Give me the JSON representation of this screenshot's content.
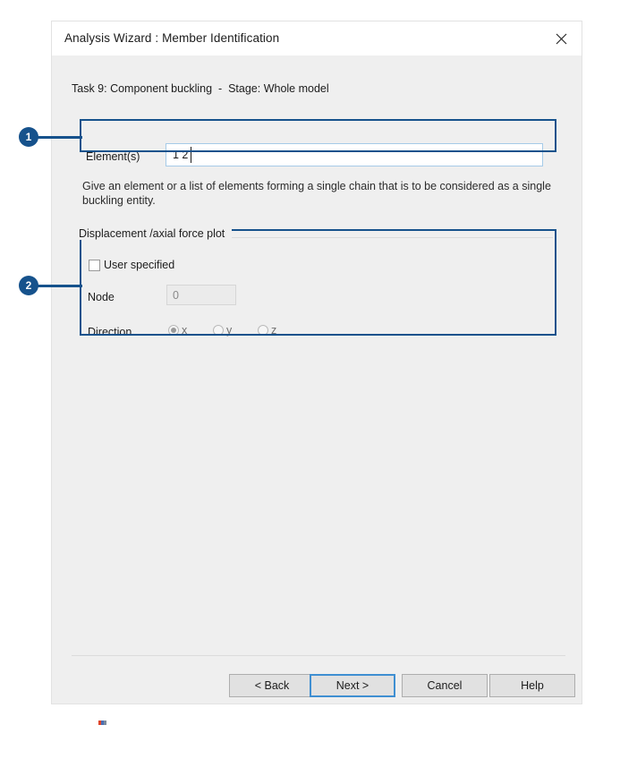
{
  "window": {
    "title": "Analysis Wizard : Member Identification",
    "close_icon": "close-icon"
  },
  "content": {
    "task_line": "Task 9: Component buckling  -  Stage: Whole model",
    "elements": {
      "label": "Element(s)",
      "value": "1 2",
      "placeholder": ""
    },
    "help_text": "Give an element or a list of elements forming a single chain that is to be considered as a single buckling entity.",
    "group": {
      "header": "Displacement /axial force plot",
      "user_specified": {
        "label": "User specified",
        "checked": false
      },
      "node": {
        "label": "Node",
        "value": "0",
        "enabled": false
      },
      "direction": {
        "label": "Direction",
        "selected": "x",
        "options": [
          {
            "value": "x",
            "label": "x",
            "checked": true
          },
          {
            "value": "y",
            "label": "y",
            "checked": false
          },
          {
            "value": "z",
            "label": "z",
            "checked": false
          }
        ]
      }
    }
  },
  "footer": {
    "back_label": "< Back",
    "next_label": "Next >",
    "cancel_label": "Cancel",
    "help_label": "Help"
  },
  "annotations": {
    "badge_1": "1",
    "badge_2": "2",
    "color": "#16528c"
  }
}
